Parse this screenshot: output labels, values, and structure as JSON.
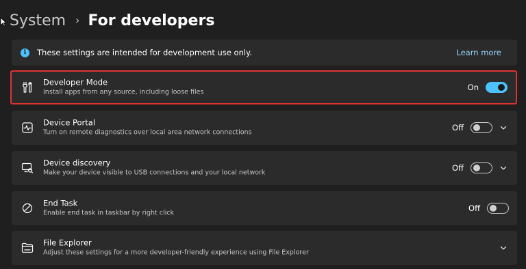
{
  "breadcrumb": {
    "parent": "System",
    "separator": "›",
    "current": "For developers"
  },
  "info_bar": {
    "icon": "info-icon",
    "text": "These settings are intended for development use only.",
    "link": "Learn more"
  },
  "settings": [
    {
      "icon": "developer-tools-icon",
      "title": "Developer Mode",
      "description": "Install apps from any source, including loose files",
      "state_label": "On",
      "toggle_on": true,
      "has_chevron": false,
      "highlighted": true
    },
    {
      "icon": "device-portal-icon",
      "title": "Device Portal",
      "description": "Turn on remote diagnostics over local area network connections",
      "state_label": "Off",
      "toggle_on": false,
      "has_chevron": true,
      "highlighted": false
    },
    {
      "icon": "device-discovery-icon",
      "title": "Device discovery",
      "description": "Make your device visible to USB connections and your local network",
      "state_label": "Off",
      "toggle_on": false,
      "has_chevron": true,
      "highlighted": false
    },
    {
      "icon": "end-task-icon",
      "title": "End Task",
      "description": "Enable end task in taskbar by right click",
      "state_label": "Off",
      "toggle_on": false,
      "has_chevron": false,
      "highlighted": false
    },
    {
      "icon": "folder-icon",
      "title": "File Explorer",
      "description": "Adjust these settings for a more developer-friendly experience using File Explorer",
      "has_chevron": true,
      "highlighted": false
    }
  ],
  "colors": {
    "background": "#1f1f1f",
    "card": "#2b2b2b",
    "accent": "#4cc2ff",
    "link": "#99d9ff",
    "highlight_border": "#e03232"
  }
}
